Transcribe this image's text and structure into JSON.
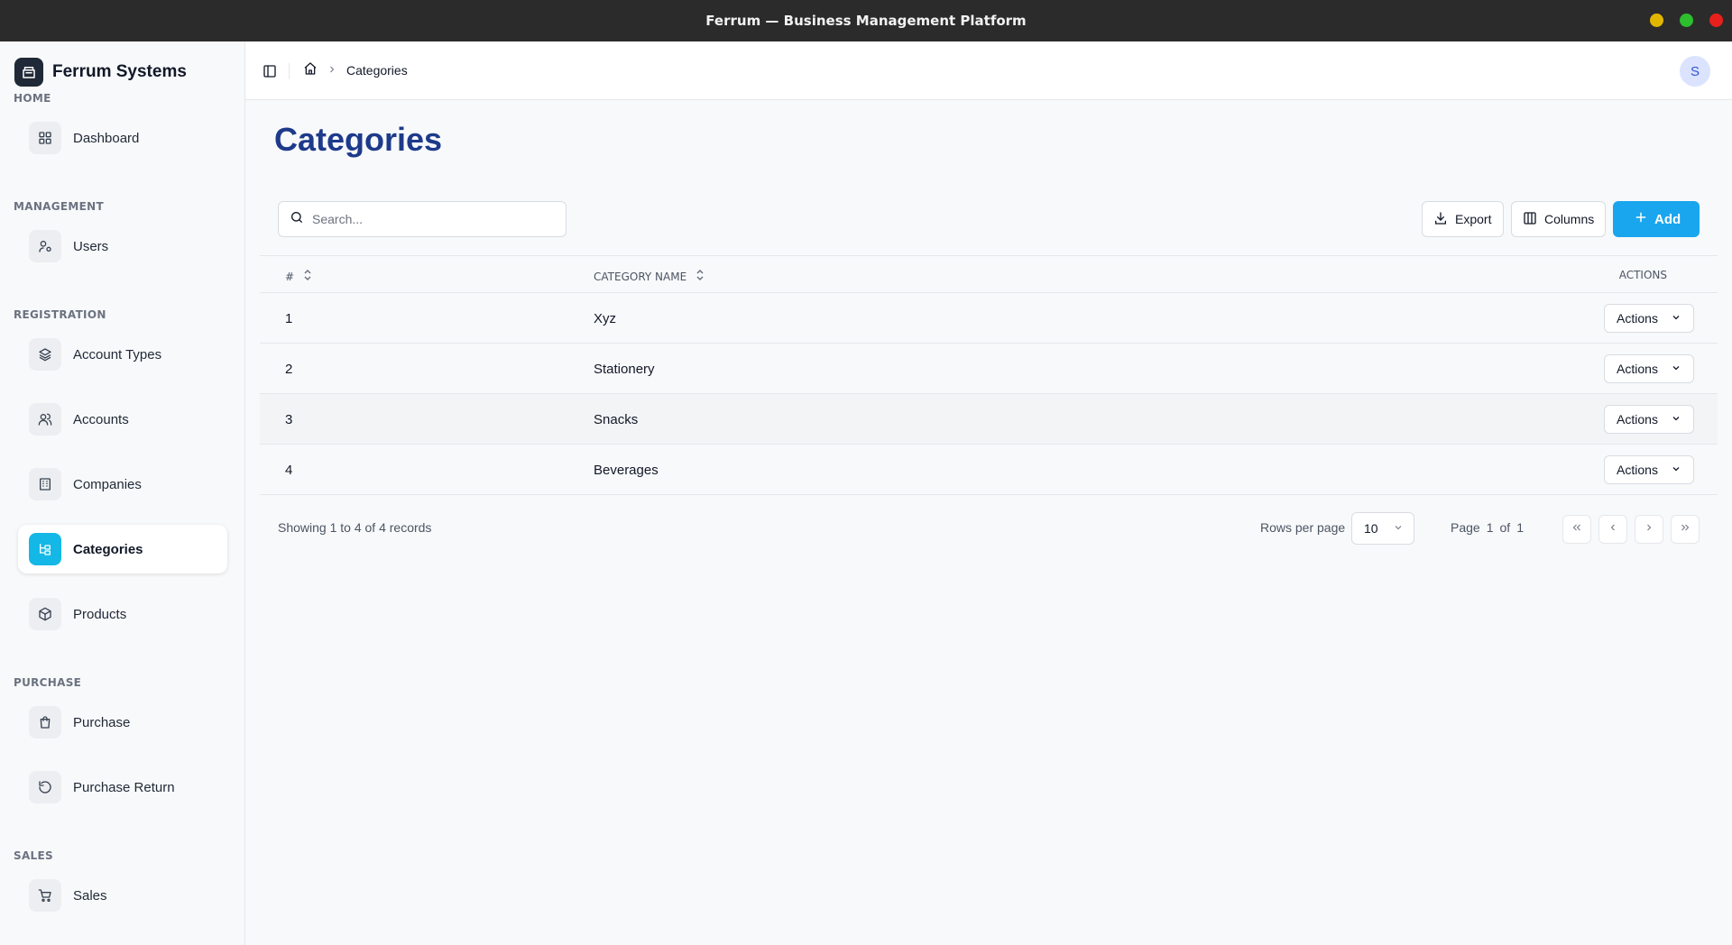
{
  "window": {
    "title": "Ferrum — Business Management Platform",
    "controls": [
      {
        "name": "minimize",
        "color": "#e0b600"
      },
      {
        "name": "maximize",
        "color": "#2dbd2d"
      },
      {
        "name": "close",
        "color": "#e8201b"
      }
    ]
  },
  "brand": {
    "name": "Ferrum Systems",
    "icon": "store-icon"
  },
  "sidebar": {
    "sections": {
      "home": "HOME",
      "management": "MANAGEMENT",
      "registration": "REGISTRATION",
      "purchase": "PURCHASE",
      "sales": "SALES"
    },
    "items": [
      {
        "label": "Dashboard",
        "icon": "grid-icon"
      },
      {
        "label": "Users",
        "icon": "user-settings-icon"
      },
      {
        "label": "Account Types",
        "icon": "layers-icon"
      },
      {
        "label": "Accounts",
        "icon": "users-icon"
      },
      {
        "label": "Companies",
        "icon": "building-icon"
      },
      {
        "label": "Categories",
        "icon": "category-tree-icon",
        "active": true
      },
      {
        "label": "Products",
        "icon": "box-icon"
      },
      {
        "label": "Purchase",
        "icon": "shopping-bag-icon"
      },
      {
        "label": "Purchase Return",
        "icon": "rotate-ccw-icon"
      },
      {
        "label": "Sales",
        "icon": "cart-icon"
      }
    ]
  },
  "header": {
    "breadcrumb": {
      "current": "Categories"
    },
    "avatar_initial": "S"
  },
  "page": {
    "title": "Categories",
    "search_placeholder": "Search...",
    "export_label": "Export",
    "columns_label": "Columns",
    "add_label": "Add"
  },
  "table": {
    "headers": {
      "index": "#",
      "name": "CATEGORY NAME",
      "actions": "ACTIONS"
    },
    "rows": [
      {
        "index": "1",
        "name": "Xyz",
        "action": "Actions"
      },
      {
        "index": "2",
        "name": "Stationery",
        "action": "Actions"
      },
      {
        "index": "3",
        "name": "Snacks",
        "action": "Actions"
      },
      {
        "index": "4",
        "name": "Beverages",
        "action": "Actions"
      }
    ]
  },
  "pagination": {
    "records_text": "Showing 1 to 4 of 4 records",
    "rows_per_page_label": "Rows per page",
    "rows_per_page_value": "10",
    "page_label": "Page",
    "page_current": "1",
    "page_of": "of",
    "page_total": "1"
  },
  "colors": {
    "accent": "#19a6ee",
    "title": "#1e3a8a",
    "active_icon": "#14b8e6"
  }
}
